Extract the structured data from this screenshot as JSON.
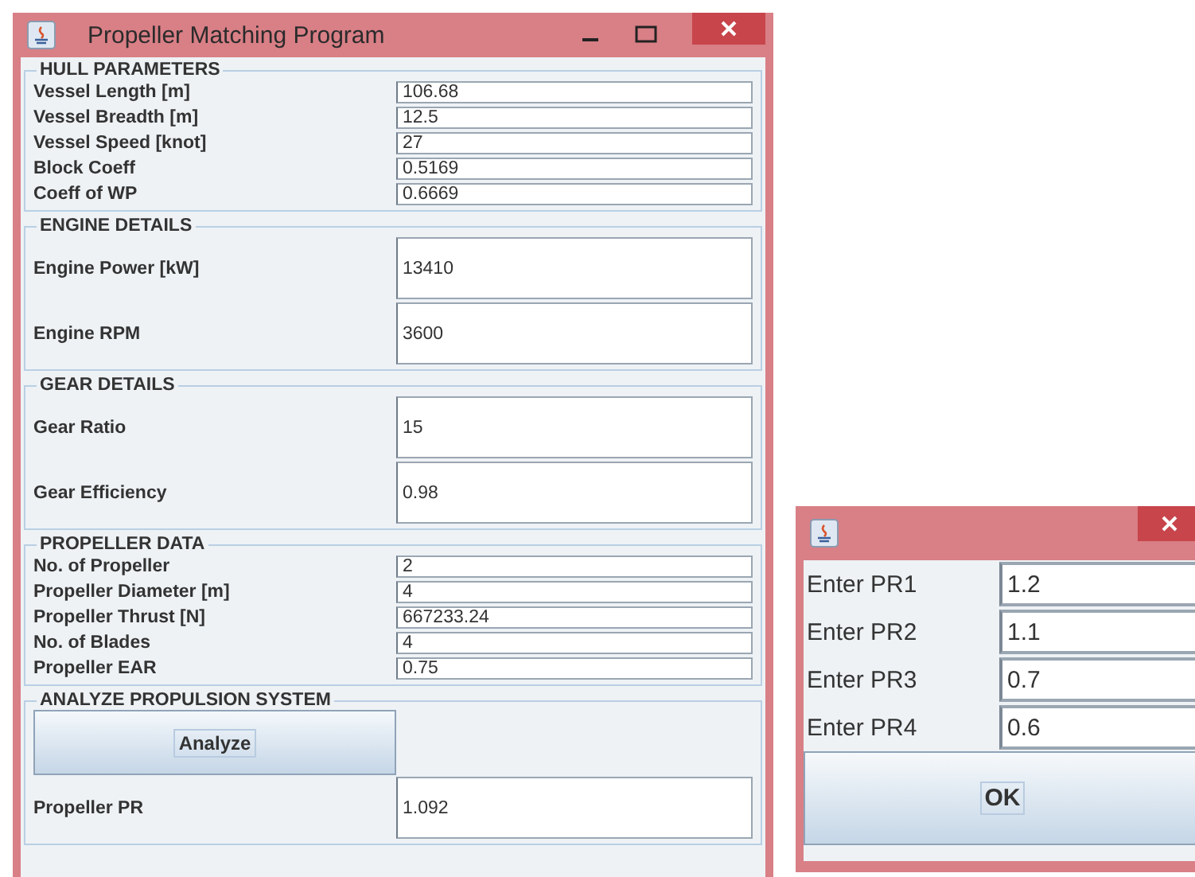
{
  "main_window": {
    "title": "Propeller Matching Program",
    "sections": [
      {
        "title": "HULL PARAMETERS",
        "kind": "compact",
        "fields": [
          {
            "label": "Vessel Length [m]",
            "value": "106.68"
          },
          {
            "label": "Vessel Breadth [m]",
            "value": "12.5"
          },
          {
            "label": "Vessel Speed [knot]",
            "value": "27"
          },
          {
            "label": "Block Coeff",
            "value": "0.5169"
          },
          {
            "label": "Coeff of WP",
            "value": "0.6669"
          }
        ]
      },
      {
        "title": "ENGINE DETAILS",
        "kind": "tall",
        "fields": [
          {
            "label": "Engine Power [kW]",
            "value": "13410"
          },
          {
            "label": "Engine RPM",
            "value": "3600"
          }
        ]
      },
      {
        "title": "GEAR DETAILS",
        "kind": "tall",
        "fields": [
          {
            "label": "Gear Ratio",
            "value": "15"
          },
          {
            "label": "Gear Efficiency",
            "value": "0.98"
          }
        ]
      },
      {
        "title": "PROPELLER DATA",
        "kind": "compact",
        "fields": [
          {
            "label": "No. of Propeller",
            "value": "2"
          },
          {
            "label": "Propeller Diameter [m]",
            "value": "4"
          },
          {
            "label": "Propeller Thrust [N]",
            "value": "667233.24"
          },
          {
            "label": "No. of Blades",
            "value": "4"
          },
          {
            "label": "Propeller EAR",
            "value": "0.75"
          }
        ]
      },
      {
        "title": "ANALYZE PROPULSION SYSTEM",
        "kind": "action",
        "button": "Analyze",
        "fields": [
          {
            "label": "Propeller PR",
            "value": "1.092"
          }
        ]
      }
    ]
  },
  "dialog": {
    "fields": [
      {
        "label": "Enter PR1",
        "value": "1.2"
      },
      {
        "label": "Enter PR2",
        "value": "1.1"
      },
      {
        "label": "Enter PR3",
        "value": "0.7"
      },
      {
        "label": "Enter PR4",
        "value": "0.6"
      }
    ],
    "button": "OK"
  }
}
